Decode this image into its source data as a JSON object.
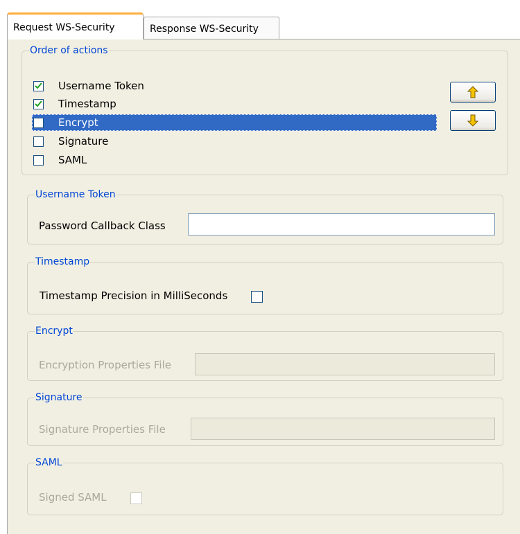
{
  "tabs": [
    {
      "label": "Request WS-Security",
      "active": true
    },
    {
      "label": "Response WS-Security",
      "active": false
    }
  ],
  "order_group": {
    "title": "Order of actions",
    "items": [
      {
        "label": "Username Token",
        "checked": true
      },
      {
        "label": "Timestamp",
        "checked": true
      },
      {
        "label": "Encrypt",
        "checked": false,
        "selected": true
      },
      {
        "label": "Signature",
        "checked": false
      },
      {
        "label": "SAML",
        "checked": false
      }
    ],
    "up_icon": "arrow-up-icon",
    "down_icon": "arrow-down-icon"
  },
  "username_group": {
    "title": "Username Token",
    "password_label": "Password Callback Class",
    "password_value": ""
  },
  "timestamp_group": {
    "title": "Timestamp",
    "precision_label": "Timestamp Precision in MilliSeconds",
    "precision_checked": false
  },
  "encrypt_group": {
    "title": "Encrypt",
    "properties_label": "Encryption Properties File",
    "properties_value": ""
  },
  "signature_group": {
    "title": "Signature",
    "properties_label": "Signature Properties File",
    "properties_value": ""
  },
  "saml_group": {
    "title": "SAML",
    "signed_label": "Signed SAML",
    "signed_checked": false
  },
  "colors": {
    "panel_bg": "#f1efe2",
    "group_title": "#0046d5",
    "selection": "#316ac5",
    "active_tab_accent": "#ffad3d",
    "arrow_fill": "#f5c400",
    "disabled_text": "#aca899"
  }
}
